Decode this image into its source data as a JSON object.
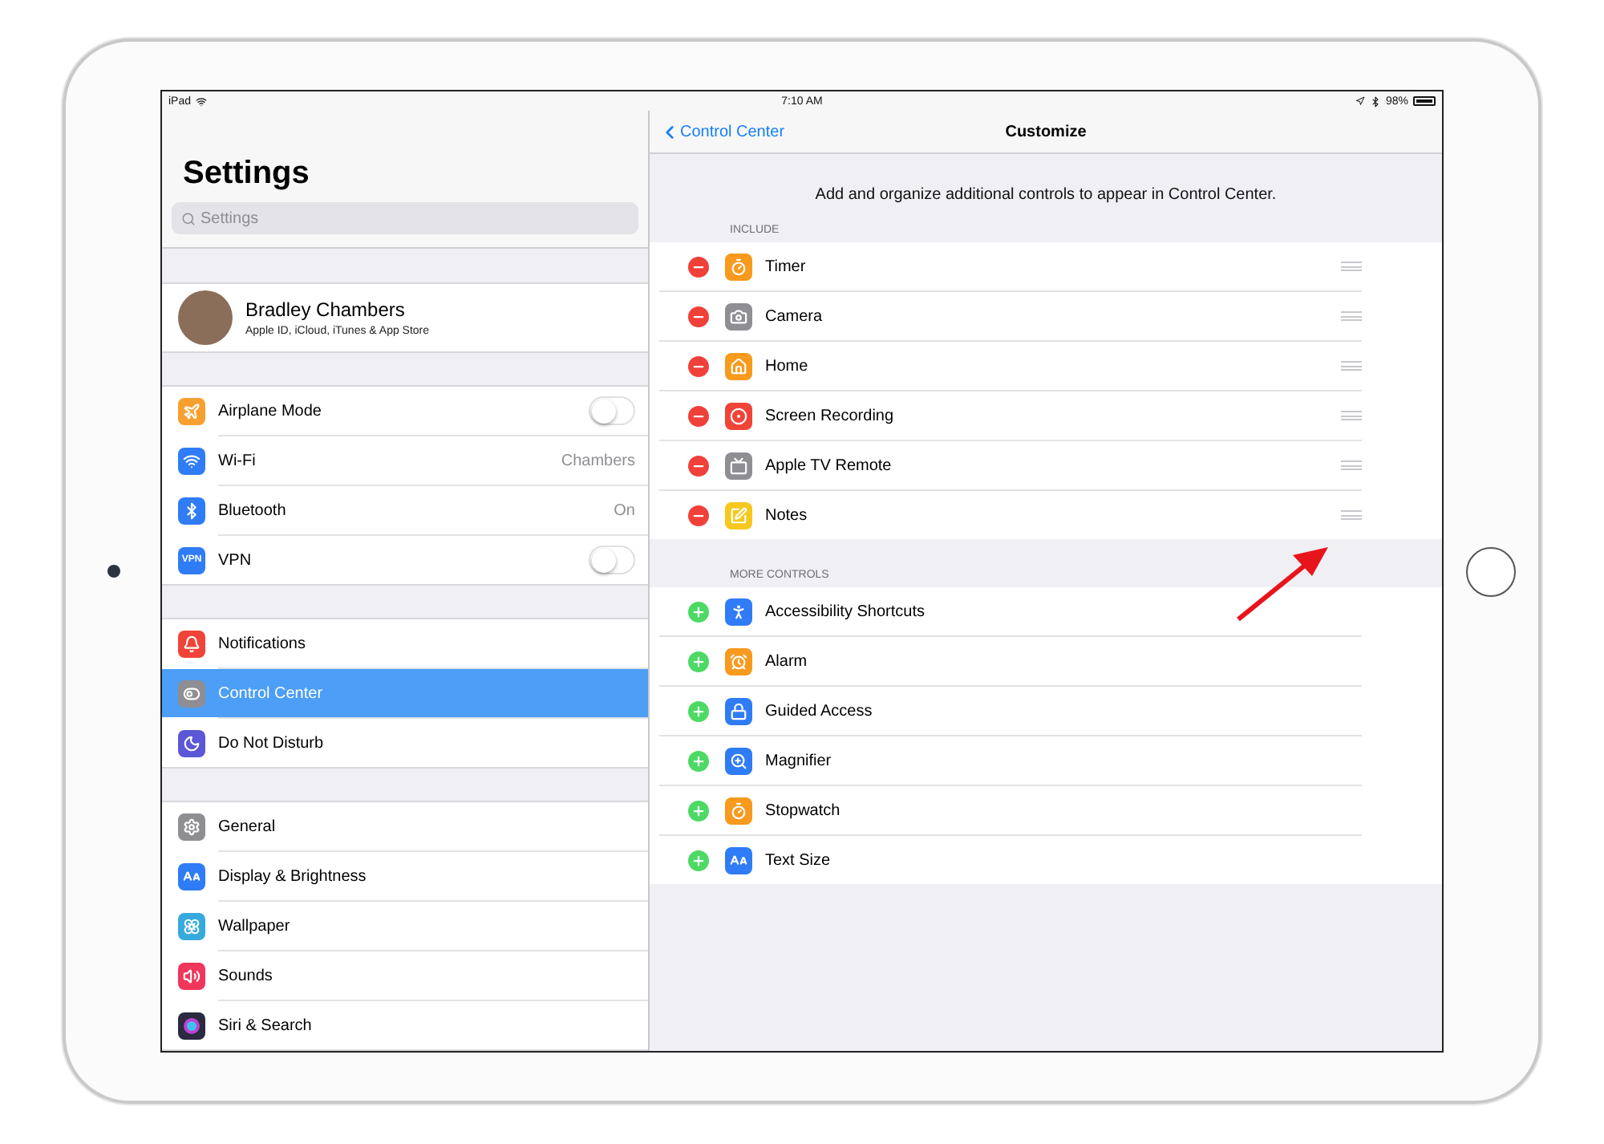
{
  "status_bar": {
    "device": "iPad",
    "time": "7:10 AM",
    "battery": "98%"
  },
  "sidebar": {
    "title": "Settings",
    "search": {
      "placeholder": "Settings"
    },
    "profile": {
      "name": "Bradley Chambers",
      "subtitle": "Apple ID, iCloud, iTunes & App Store"
    },
    "groups": [
      [
        {
          "label": "Airplane Mode",
          "kind": "toggle",
          "on": false,
          "selected": false,
          "color": "#f7a030"
        },
        {
          "label": "Wi-Fi",
          "kind": "value",
          "value": "Chambers",
          "selected": false,
          "color": "#2f7cf6"
        },
        {
          "label": "Bluetooth",
          "kind": "value",
          "value": "On",
          "selected": false,
          "color": "#2f7cf6"
        },
        {
          "label": "VPN",
          "kind": "toggle",
          "on": false,
          "selected": false,
          "color": "#2f7cf6",
          "icon_text": "VPN"
        }
      ],
      [
        {
          "label": "Notifications",
          "kind": "link",
          "selected": false,
          "color": "#f04438"
        },
        {
          "label": "Control Center",
          "kind": "link",
          "selected": true,
          "color": "#8e8e93"
        },
        {
          "label": "Do Not Disturb",
          "kind": "link",
          "selected": false,
          "color": "#5b57d6"
        }
      ],
      [
        {
          "label": "General",
          "kind": "link",
          "selected": false,
          "color": "#8e8e93"
        },
        {
          "label": "Display & Brightness",
          "kind": "link",
          "selected": false,
          "color": "#2f7cf6"
        },
        {
          "label": "Wallpaper",
          "kind": "link",
          "selected": false,
          "color": "#36aadc"
        },
        {
          "label": "Sounds",
          "kind": "link",
          "selected": false,
          "color": "#f0365a"
        },
        {
          "label": "Siri & Search",
          "kind": "link",
          "selected": false,
          "color": "#2a2a40"
        }
      ]
    ]
  },
  "detail": {
    "back": "Control Center",
    "title": "Customize",
    "description": "Add and organize additional controls to appear in Control Center.",
    "sections": [
      {
        "header": "INCLUDE",
        "kind": "remove",
        "items": [
          {
            "label": "Timer",
            "color": "#f79a1e"
          },
          {
            "label": "Camera",
            "color": "#8e8e93"
          },
          {
            "label": "Home",
            "color": "#f79a1e"
          },
          {
            "label": "Screen Recording",
            "color": "#f04438"
          },
          {
            "label": "Apple TV Remote",
            "color": "#8e8e93"
          },
          {
            "label": "Notes",
            "color": "#f7c81e"
          }
        ]
      },
      {
        "header": "MORE CONTROLS",
        "kind": "add",
        "items": [
          {
            "label": "Accessibility Shortcuts",
            "color": "#2f7cf6"
          },
          {
            "label": "Alarm",
            "color": "#f79a1e"
          },
          {
            "label": "Guided Access",
            "color": "#2f7cf6"
          },
          {
            "label": "Magnifier",
            "color": "#2f7cf6"
          },
          {
            "label": "Stopwatch",
            "color": "#f79a1e"
          },
          {
            "label": "Text Size",
            "color": "#2f7cf6"
          }
        ]
      }
    ]
  }
}
